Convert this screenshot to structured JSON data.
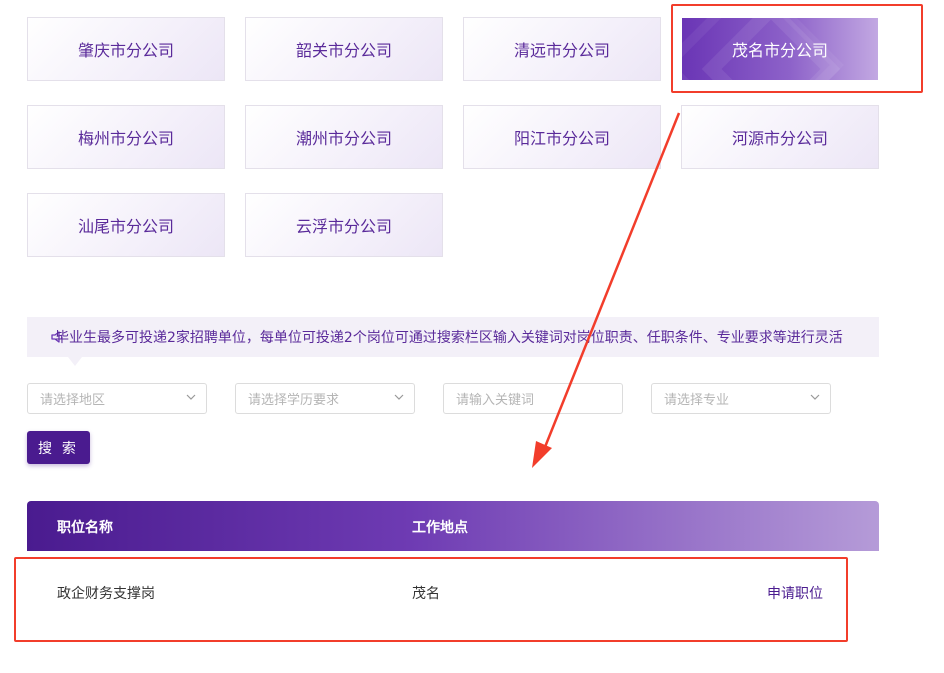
{
  "branches": [
    {
      "label": "肇庆市分公司",
      "active": false
    },
    {
      "label": "韶关市分公司",
      "active": false
    },
    {
      "label": "清远市分公司",
      "active": false
    },
    {
      "label": "茂名市分公司",
      "active": true
    },
    {
      "label": "梅州市分公司",
      "active": false
    },
    {
      "label": "潮州市分公司",
      "active": false
    },
    {
      "label": "阳江市分公司",
      "active": false
    },
    {
      "label": "河源市分公司",
      "active": false
    },
    {
      "label": "汕尾市分公司",
      "active": false
    },
    {
      "label": "云浮市分公司",
      "active": false
    }
  ],
  "notice": {
    "icon": "speaker-icon",
    "text": "毕业生最多可投递2家招聘单位，每单位可投递2个岗位可通过搜索栏区输入关键词对岗位职责、任职条件、专业要求等进行灵活"
  },
  "filters": {
    "region_placeholder": "请选择地区",
    "education_placeholder": "请选择学历要求",
    "keyword_placeholder": "请输入关键词",
    "major_placeholder": "请选择专业"
  },
  "search_label": "搜 索",
  "table": {
    "headers": {
      "position": "职位名称",
      "location": "工作地点"
    },
    "rows": [
      {
        "position": "政企财务支撑岗",
        "location": "茂名",
        "action": "申请职位"
      }
    ]
  },
  "colors": {
    "accent": "#4a1b8f",
    "highlight": "#f23d2b"
  }
}
